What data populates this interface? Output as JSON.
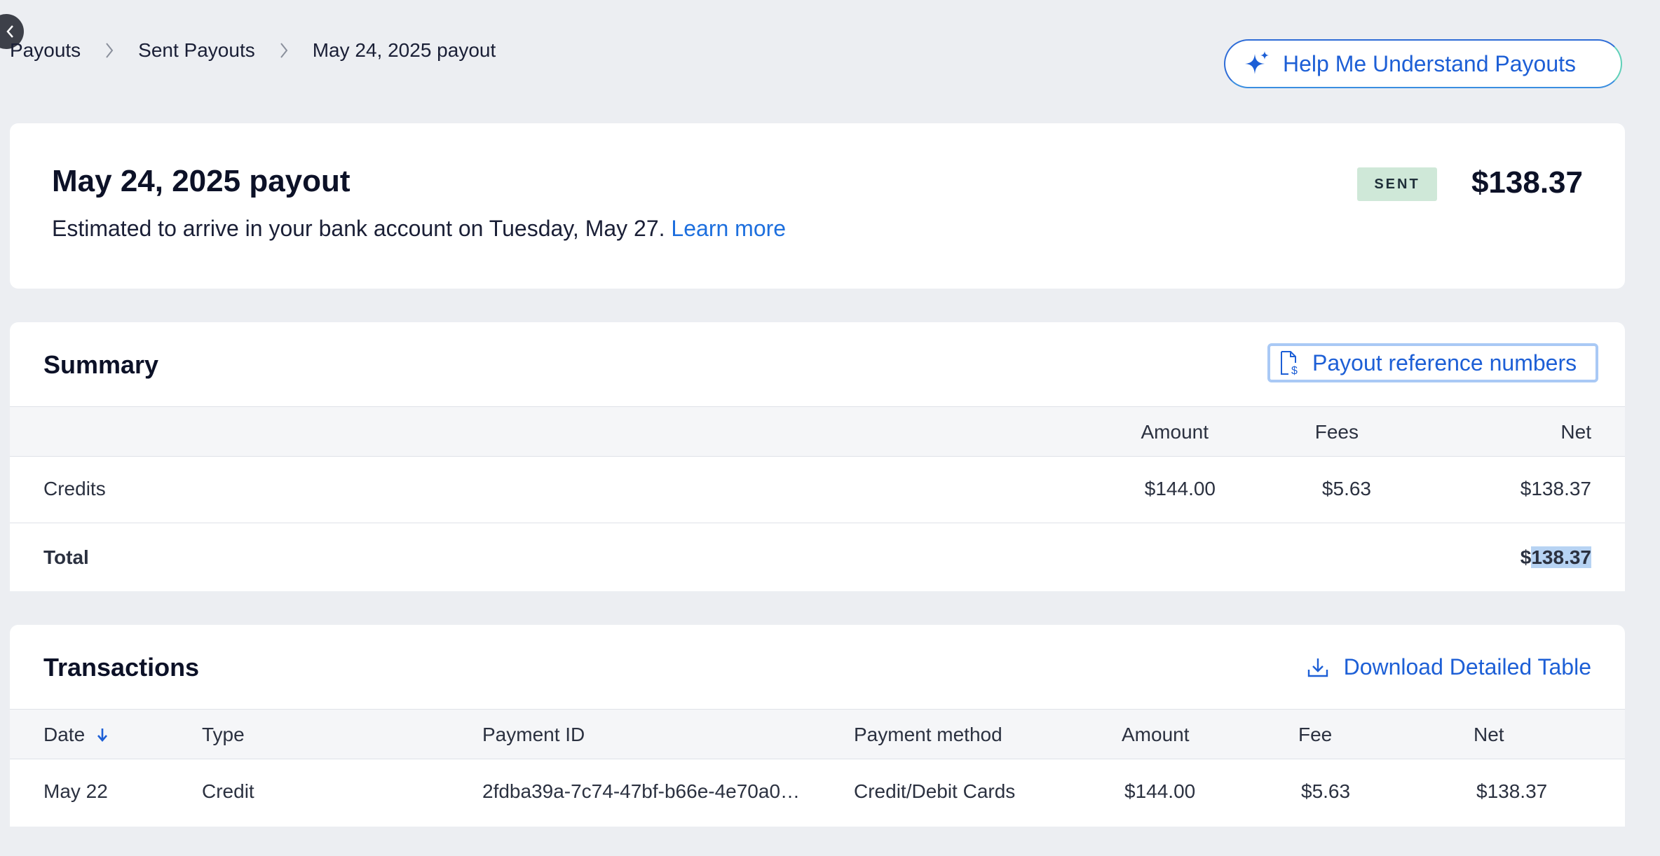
{
  "breadcrumb": {
    "items": [
      "Payouts",
      "Sent Payouts",
      "May 24, 2025 payout"
    ]
  },
  "help_button": {
    "label": "Help Me Understand Payouts"
  },
  "payout": {
    "title": "May 24, 2025 payout",
    "subtitle": "Estimated to arrive in your bank account on Tuesday, May 27.",
    "learn_more": "Learn more",
    "status": "SENT",
    "amount": "$138.37"
  },
  "summary": {
    "title": "Summary",
    "ref_button": "Payout reference numbers",
    "columns": {
      "amount": "Amount",
      "fees": "Fees",
      "net": "Net"
    },
    "credits": {
      "label": "Credits",
      "amount": "$144.00",
      "fees": "$5.63",
      "net": "$138.37"
    },
    "total": {
      "label": "Total",
      "net_prefix": "$",
      "net_value": "138.37"
    }
  },
  "transactions": {
    "title": "Transactions",
    "download_button": "Download Detailed Table",
    "columns": {
      "date": "Date",
      "type": "Type",
      "payment_id": "Payment ID",
      "method": "Payment method",
      "amount": "Amount",
      "fee": "Fee",
      "net": "Net"
    },
    "rows": [
      {
        "date": "May 22",
        "type": "Credit",
        "payment_id": "2fdba39a-7c74-47bf-b66e-4e70a0…",
        "method": "Credit/Debit Cards",
        "amount": "$144.00",
        "fee": "$5.63",
        "net": "$138.37"
      }
    ]
  },
  "colors": {
    "accent": "#1d5fd6",
    "badge_bg": "#cfe8d8",
    "page_bg": "#eceef2"
  }
}
